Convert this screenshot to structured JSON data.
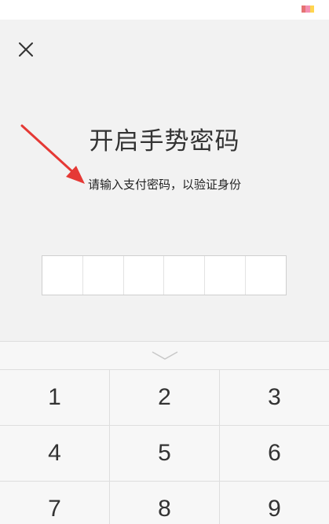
{
  "colors": {
    "background": "#f2f2f2",
    "title_text": "#333333",
    "arrow": "#e53935",
    "status_indicator": [
      "#e57373",
      "#f48fb1",
      "#ffd54f"
    ]
  },
  "header": {
    "close_icon": "close-icon"
  },
  "main": {
    "title": "开启手势密码",
    "subtitle": "请输入支付密码，以验证身份",
    "pin_length": 6
  },
  "keyboard": {
    "toggle_icon": "chevron-down-icon",
    "rows": [
      [
        "1",
        "2",
        "3"
      ],
      [
        "4",
        "5",
        "6"
      ],
      [
        "7",
        "8",
        "9"
      ]
    ]
  }
}
